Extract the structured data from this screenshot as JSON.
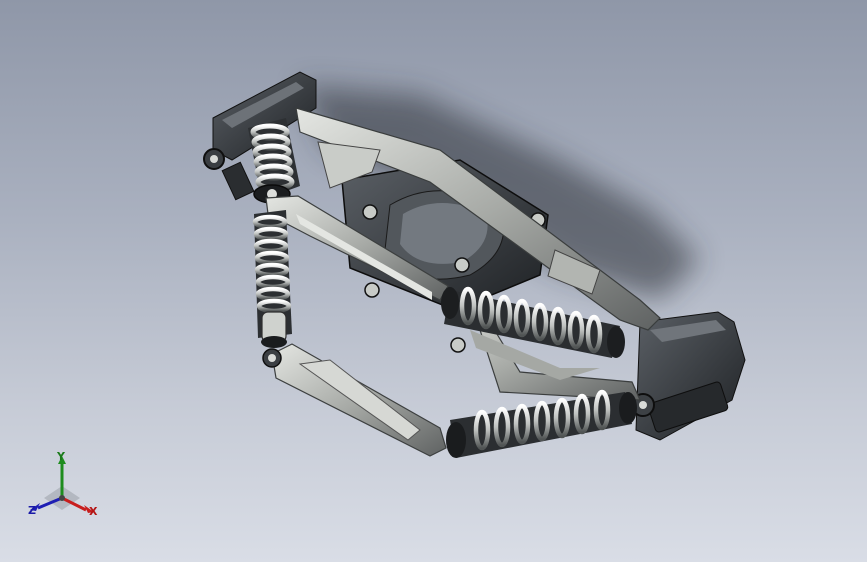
{
  "viewport": {
    "background_top": "#8f97a8",
    "background_bottom": "#d9dde6"
  },
  "model": {
    "icon": "suspension-assembly-render",
    "colors": {
      "dark_body": "#2e3236",
      "metal_light": "#c9ccc8",
      "metal_mid": "#8e9291",
      "spring_highlight": "#f2f2f2"
    }
  },
  "triad": {
    "x_label": "X",
    "y_label": "Y",
    "z_label": "Z",
    "colors": {
      "x": "#c81e1e",
      "y": "#1e8c1e",
      "z": "#1e1eb4"
    }
  }
}
